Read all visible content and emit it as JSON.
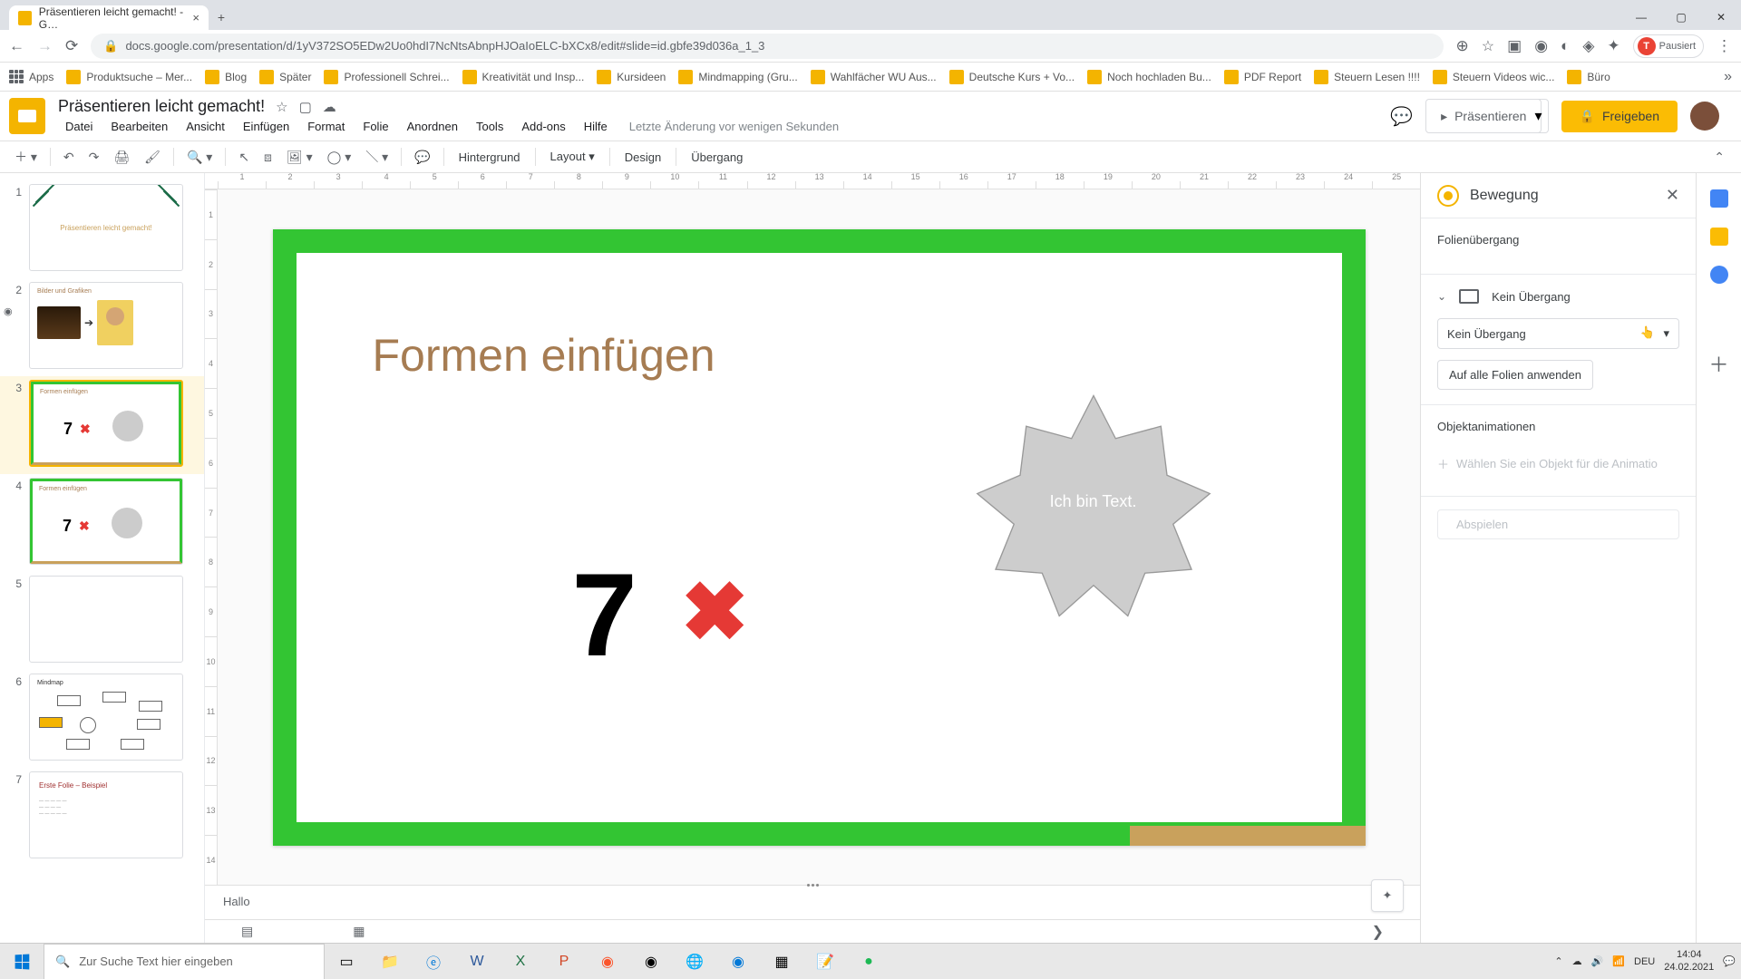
{
  "browser": {
    "tab_title": "Präsentieren leicht gemacht! - G…",
    "url": "docs.google.com/presentation/d/1yV372SO5EDw2Uo0hdI7NcNtsAbnpHJOaIoELC-bXCx8/edit#slide=id.gbfe39d036a_1_3",
    "profile_status": "Pausiert"
  },
  "bookmarks": [
    "Apps",
    "Produktsuche – Mer...",
    "Blog",
    "Später",
    "Professionell Schrei...",
    "Kreativität und Insp...",
    "Kursideen",
    "Mindmapping  (Gru...",
    "Wahlfächer WU Aus...",
    "Deutsche Kurs + Vo...",
    "Noch hochladen Bu...",
    "PDF Report",
    "Steuern Lesen !!!!",
    "Steuern Videos wic...",
    "Büro"
  ],
  "doc": {
    "title": "Präsentieren leicht gemacht!",
    "last_edit": "Letzte Änderung vor wenigen Sekunden"
  },
  "menus": [
    "Datei",
    "Bearbeiten",
    "Ansicht",
    "Einfügen",
    "Format",
    "Folie",
    "Anordnen",
    "Tools",
    "Add-ons",
    "Hilfe"
  ],
  "header_buttons": {
    "present": "Präsentieren",
    "share": "Freigeben"
  },
  "toolbar": {
    "background": "Hintergrund",
    "layout": "Layout",
    "design": "Design",
    "transition": "Übergang"
  },
  "ruler_h": [
    "1",
    "2",
    "3",
    "4",
    "5",
    "6",
    "7",
    "8",
    "9",
    "10",
    "11",
    "12",
    "13",
    "14",
    "15",
    "16",
    "17",
    "18",
    "19",
    "20",
    "21",
    "22",
    "23",
    "24",
    "25"
  ],
  "ruler_v": [
    "1",
    "2",
    "3",
    "4",
    "5",
    "6",
    "7",
    "8",
    "9",
    "10",
    "11",
    "12",
    "13",
    "14"
  ],
  "slide": {
    "title": "Formen einfügen",
    "seven": "7",
    "x": "✖",
    "star_text": "Ich bin Text."
  },
  "notes": "Hallo",
  "motion": {
    "panel_title": "Bewegung",
    "transition_heading": "Folienübergang",
    "transition_current": "Kein Übergang",
    "dropdown_value": "Kein Übergang",
    "apply_all": "Auf alle Folien anwenden",
    "object_heading": "Objektanimationen",
    "select_hint": "Wählen Sie ein Objekt für die Animatio",
    "play": "Abspielen"
  },
  "thumbnails": [
    {
      "num": "1",
      "title": "Präsentieren leicht gemacht!"
    },
    {
      "num": "2",
      "title": "Bilder und Grafiken"
    },
    {
      "num": "3",
      "title": "Formen einfügen",
      "selected": true
    },
    {
      "num": "4",
      "title": "Formen einfügen"
    },
    {
      "num": "5",
      "title": ""
    },
    {
      "num": "6",
      "title": "Mindmap"
    },
    {
      "num": "7",
      "title": "Erste Folie – Beispiel"
    }
  ],
  "taskbar": {
    "search_placeholder": "Zur Suche Text hier eingeben",
    "lang": "DEU",
    "time": "14:04",
    "date": "24.02.2021"
  }
}
